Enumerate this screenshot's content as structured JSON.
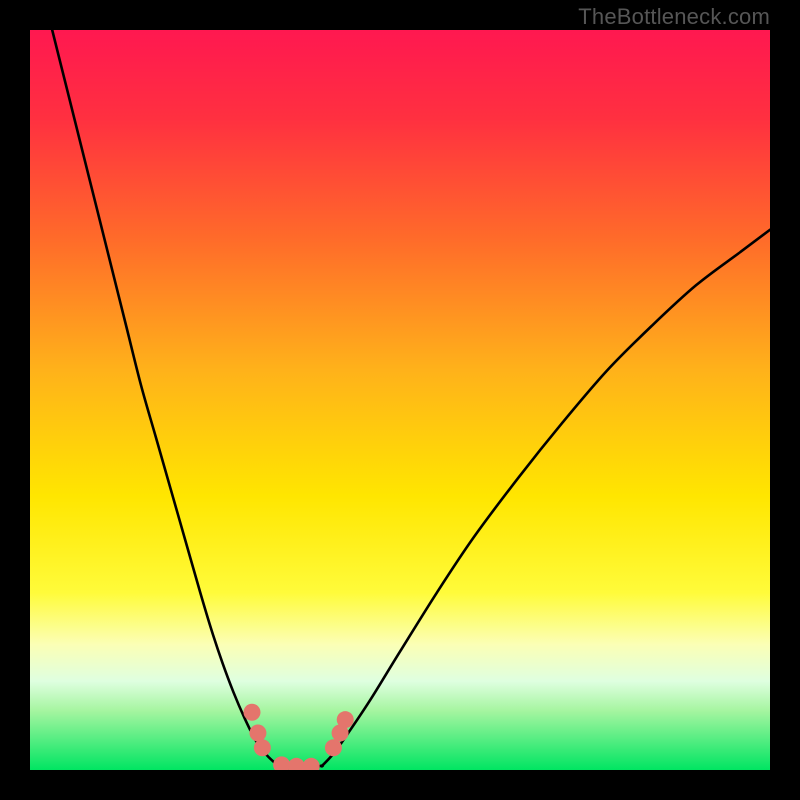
{
  "watermark": "TheBottleneck.com",
  "colors": {
    "black": "#000000",
    "curve": "#000000",
    "dots": "#e4756c",
    "green_band_top": "#8fe97b",
    "green_band_bottom": "#00e562"
  },
  "chart_data": {
    "type": "line",
    "title": "",
    "xlabel": "",
    "ylabel": "",
    "xlim": [
      0,
      100
    ],
    "ylim": [
      0,
      100
    ],
    "background_gradient_stops": [
      {
        "offset": 0.0,
        "color": "#ff1850"
      },
      {
        "offset": 0.12,
        "color": "#ff3040"
      },
      {
        "offset": 0.28,
        "color": "#ff6a2a"
      },
      {
        "offset": 0.46,
        "color": "#ffb21a"
      },
      {
        "offset": 0.63,
        "color": "#ffe600"
      },
      {
        "offset": 0.76,
        "color": "#fffb3a"
      },
      {
        "offset": 0.83,
        "color": "#fbffb5"
      },
      {
        "offset": 0.88,
        "color": "#dfffe0"
      },
      {
        "offset": 0.92,
        "color": "#a5f5a0"
      },
      {
        "offset": 1.0,
        "color": "#00e562"
      }
    ],
    "series": [
      {
        "name": "bottleneck-curve",
        "branch": "left",
        "x": [
          3,
          5,
          7,
          9,
          11,
          13,
          15,
          17,
          19,
          21,
          23,
          24.5,
          26,
          27.5,
          29,
          30.5,
          32,
          33.5
        ],
        "y": [
          100,
          92,
          84,
          76,
          68,
          60,
          52,
          45,
          38,
          31,
          24,
          19,
          14.5,
          10.5,
          7,
          4,
          2,
          0.6
        ]
      },
      {
        "name": "bottleneck-curve",
        "branch": "floor",
        "x": [
          33.5,
          35,
          36.5,
          38,
          39.5
        ],
        "y": [
          0.6,
          0.3,
          0.25,
          0.3,
          0.6
        ]
      },
      {
        "name": "bottleneck-curve",
        "branch": "right",
        "x": [
          39.5,
          41,
          43,
          46,
          50,
          55,
          60,
          66,
          72,
          78,
          84,
          90,
          96,
          100
        ],
        "y": [
          0.6,
          2.2,
          5,
          9.5,
          16,
          24,
          31.5,
          39.5,
          47,
          54,
          60,
          65.5,
          70,
          73
        ]
      }
    ],
    "points": [
      {
        "name": "p1",
        "x": 30.0,
        "y": 7.8
      },
      {
        "name": "p2",
        "x": 30.8,
        "y": 5.0
      },
      {
        "name": "p3",
        "x": 31.4,
        "y": 3.0
      },
      {
        "name": "p4",
        "x": 34.0,
        "y": 0.7
      },
      {
        "name": "p5",
        "x": 36.0,
        "y": 0.5
      },
      {
        "name": "p6",
        "x": 38.0,
        "y": 0.5
      },
      {
        "name": "p7",
        "x": 41.0,
        "y": 3.0
      },
      {
        "name": "p8",
        "x": 41.9,
        "y": 5.0
      },
      {
        "name": "p9",
        "x": 42.6,
        "y": 6.8
      }
    ]
  }
}
